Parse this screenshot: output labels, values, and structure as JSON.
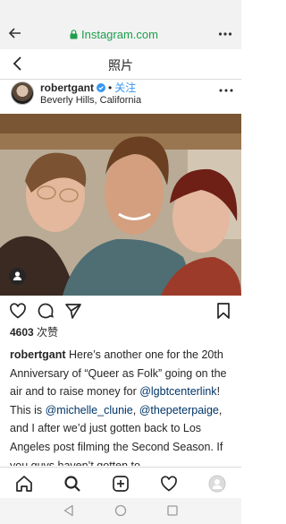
{
  "browser": {
    "url": "Instagram.com"
  },
  "page": {
    "title": "照片"
  },
  "post": {
    "username": "robertgant",
    "follow_label": "关注",
    "separator": "•",
    "location": "Beverly Hills, California",
    "likes_count": "4603",
    "likes_suffix": "次赞",
    "caption": {
      "username": "robertgant",
      "text_1": " Here’s another one for the 20th Anniversary of “Queer as Folk” going on the air and to raise money for ",
      "mention_1": "@lgbtcenterlink",
      "text_2": "! This is ",
      "mention_2": "@michelle_clunie",
      "text_3": ", ",
      "mention_3": "@thepeterpaige",
      "text_4": ", and I after we’d just gotten back to Los Angeles post filming the Second Season. If you guys haven’t gotten to"
    }
  },
  "colors": {
    "link": "#3897f0",
    "url_green": "#1e9e4f",
    "mention": "#003569"
  },
  "icons": [
    "back-arrow-icon",
    "lock-icon",
    "kebab-menu-icon",
    "chevron-left-icon",
    "verified-badge-icon",
    "more-horizontal-icon",
    "user-tag-icon",
    "heart-icon",
    "comment-icon",
    "share-icon",
    "bookmark-icon",
    "home-icon",
    "search-icon",
    "new-post-icon",
    "activity-heart-icon",
    "profile-avatar-icon",
    "nav-back-icon",
    "nav-home-icon",
    "nav-recents-icon"
  ]
}
